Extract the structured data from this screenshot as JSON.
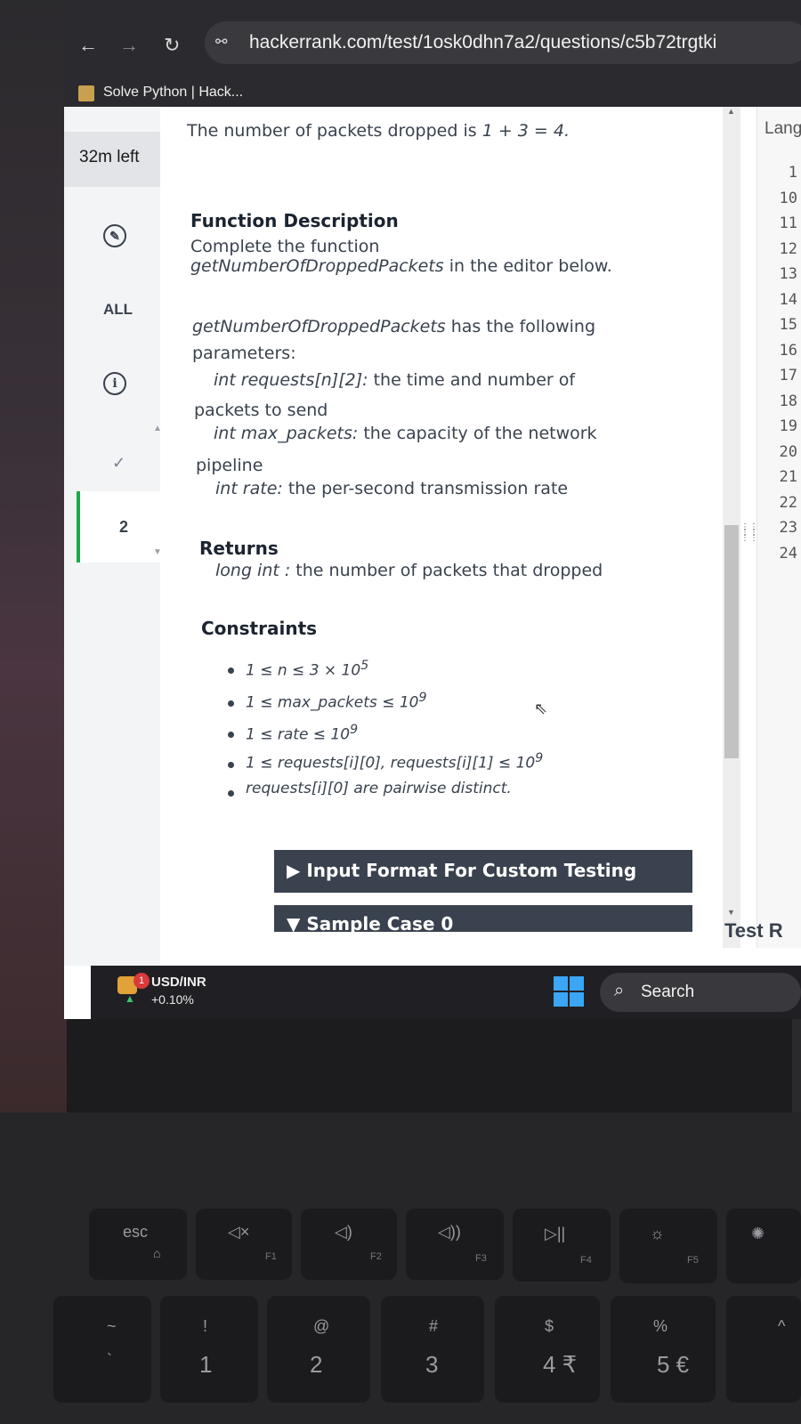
{
  "browser": {
    "url": "hackerrank.com/test/1osk0dhn7a2/questions/c5b72trgtki",
    "tab_title": "Solve Python | Hack...",
    "icons": [
      "back-icon",
      "forward-icon",
      "reload-icon",
      "site-info-icon"
    ]
  },
  "rail": {
    "timer": "32m left",
    "all_label": "ALL",
    "info_glyph": "i",
    "active_question": "2"
  },
  "problem": {
    "dropped_line_prefix": "The number of packets dropped is ",
    "dropped_line_math": "1 + 3 = 4.",
    "function_description_heading": "Function Description",
    "complete_line": "Complete the function",
    "function_name": "getNumberOfDroppedPackets",
    "in_editor_suffix": " in the editor below.",
    "has_following": " has the following",
    "parameters_word": "parameters:",
    "param1_name": "int requests[n][2]:",
    "param1_desc": " the time and number of",
    "param1_desc2": "packets to send",
    "param2_name": "int max_packets:",
    "param2_desc": " the capacity of the network",
    "param2_desc2": "pipeline",
    "param3_name": "int rate:",
    "param3_desc": " the per-second transmission rate",
    "returns_heading": "Returns",
    "returns_type": "long int :",
    "returns_desc": " the number of packets that dropped",
    "constraints_heading": "Constraints",
    "constraints": [
      {
        "text": "1 ≤ n ≤ 3 × 10",
        "sup": "5"
      },
      {
        "text": "1 ≤ max_packets ≤ 10",
        "sup": "9"
      },
      {
        "text": "1 ≤ rate ≤ 10",
        "sup": "9"
      },
      {
        "text": "1 ≤ requests[i][0], requests[i][1] ≤ 10",
        "sup": "9"
      },
      {
        "text": "requests[i][0] are pairwise distinct.",
        "sup": ""
      }
    ],
    "input_format_label": "▶ Input Format For Custom Testing",
    "sample_case_label": "▼ Sample Case 0"
  },
  "editor": {
    "language_label": "Langua",
    "line_numbers": [
      "1",
      "10",
      "11",
      "12",
      "13",
      "14",
      "15",
      "16",
      "17",
      "18",
      "19",
      "20",
      "21",
      "22",
      "23",
      "24"
    ],
    "test_results_label": "Test R"
  },
  "taskbar": {
    "ticker_badge": "1",
    "ticker_name": "USD/INR",
    "ticker_change": "+0.10%",
    "search_label": "Search"
  },
  "keyboard": {
    "esc": "esc",
    "f_keys": [
      "F1",
      "F2",
      "F3",
      "F4",
      "F5"
    ],
    "symbols": [
      "~",
      "!",
      "@",
      "#",
      "$",
      "%",
      "^"
    ],
    "numbers": [
      "`",
      "1",
      "2",
      "3",
      "4 ₹",
      "5 €"
    ]
  },
  "colors": {
    "accent_green": "#1ba94c",
    "bar_dark": "#39424e",
    "windows_blue": "#3aa6f5"
  }
}
